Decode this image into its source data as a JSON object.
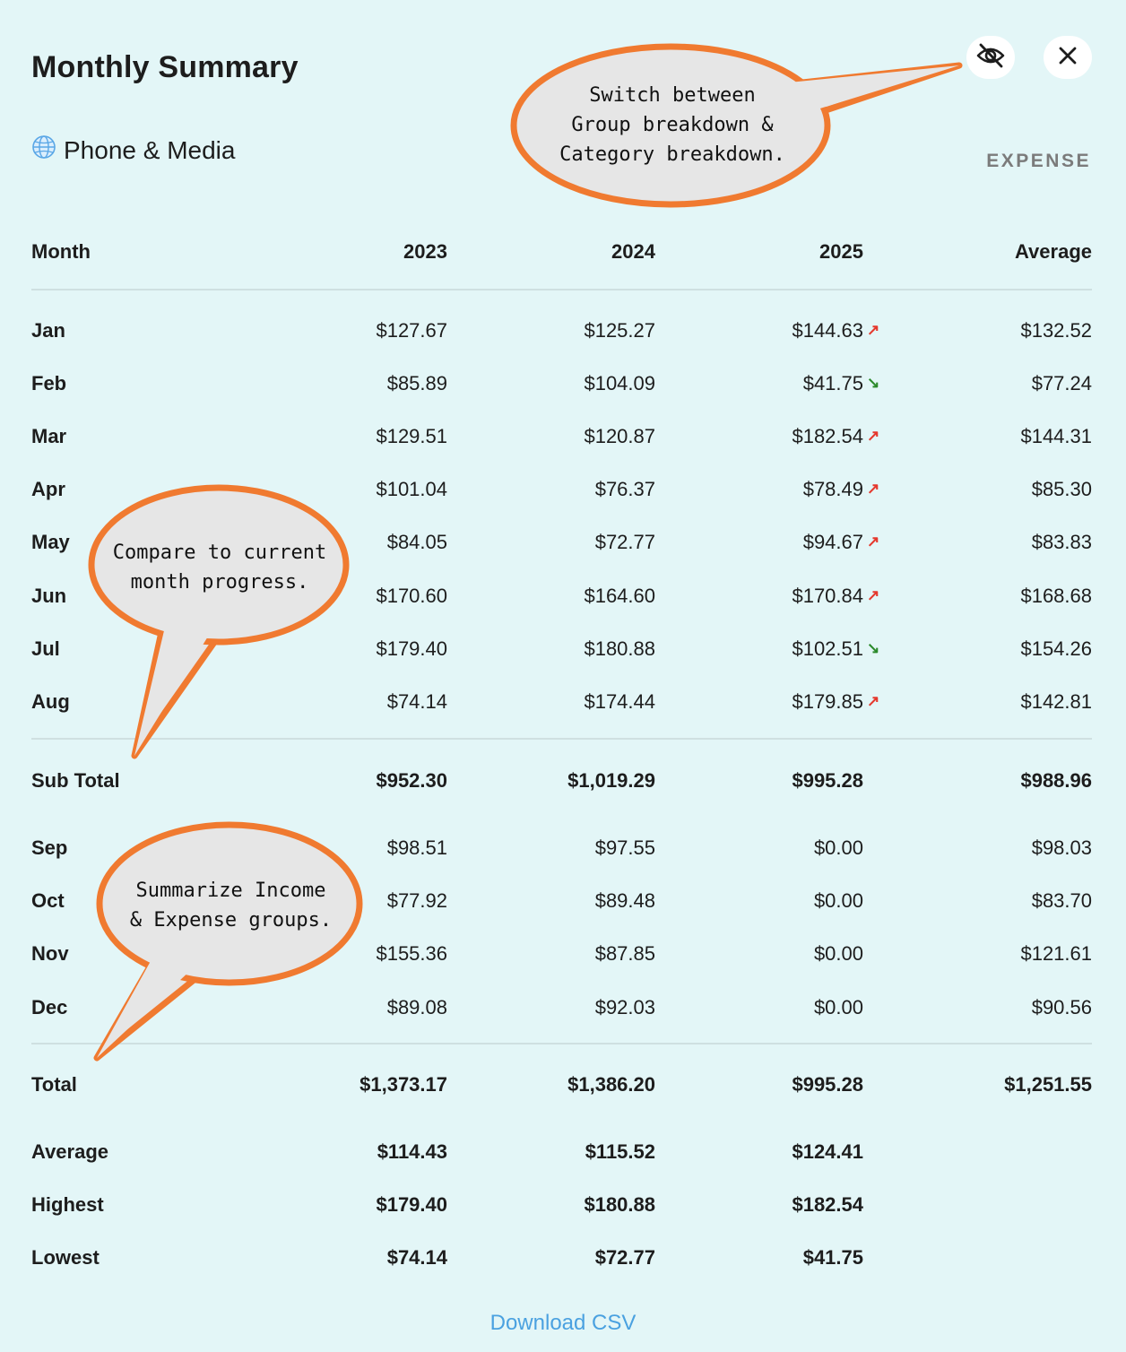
{
  "header": {
    "title": "Monthly Summary",
    "category": "Phone & Media",
    "category_icon": "globe-icon",
    "type_label": "EXPENSE",
    "toggle_icon": "eye-off-icon",
    "close_icon": "close-icon"
  },
  "table": {
    "columns": [
      "Month",
      "2023",
      "2024",
      "2025",
      "Average"
    ],
    "months_first": [
      {
        "month": "Jan",
        "y2023": "$127.67",
        "y2024": "$125.27",
        "y2025": "$144.63",
        "trend": "up",
        "avg": "$132.52"
      },
      {
        "month": "Feb",
        "y2023": "$85.89",
        "y2024": "$104.09",
        "y2025": "$41.75",
        "trend": "down",
        "avg": "$77.24"
      },
      {
        "month": "Mar",
        "y2023": "$129.51",
        "y2024": "$120.87",
        "y2025": "$182.54",
        "trend": "up",
        "avg": "$144.31"
      },
      {
        "month": "Apr",
        "y2023": "$101.04",
        "y2024": "$76.37",
        "y2025": "$78.49",
        "trend": "up",
        "avg": "$85.30"
      },
      {
        "month": "May",
        "y2023": "$84.05",
        "y2024": "$72.77",
        "y2025": "$94.67",
        "trend": "up",
        "avg": "$83.83"
      },
      {
        "month": "Jun",
        "y2023": "$170.60",
        "y2024": "$164.60",
        "y2025": "$170.84",
        "trend": "up",
        "avg": "$168.68"
      },
      {
        "month": "Jul",
        "y2023": "$179.40",
        "y2024": "$180.88",
        "y2025": "$102.51",
        "trend": "down",
        "avg": "$154.26"
      },
      {
        "month": "Aug",
        "y2023": "$74.14",
        "y2024": "$174.44",
        "y2025": "$179.85",
        "trend": "up",
        "avg": "$142.81"
      }
    ],
    "subtotal": {
      "label": "Sub Total",
      "y2023": "$952.30",
      "y2024": "$1,019.29",
      "y2025": "$995.28",
      "avg": "$988.96"
    },
    "months_rest": [
      {
        "month": "Sep",
        "y2023": "$98.51",
        "y2024": "$97.55",
        "y2025": "$0.00",
        "avg": "$98.03"
      },
      {
        "month": "Oct",
        "y2023": "$77.92",
        "y2024": "$89.48",
        "y2025": "$0.00",
        "avg": "$83.70"
      },
      {
        "month": "Nov",
        "y2023": "$155.36",
        "y2024": "$87.85",
        "y2025": "$0.00",
        "avg": "$121.61"
      },
      {
        "month": "Dec",
        "y2023": "$89.08",
        "y2024": "$92.03",
        "y2025": "$0.00",
        "avg": "$90.56"
      }
    ],
    "stats": [
      {
        "label": "Total",
        "y2023": "$1,373.17",
        "y2024": "$1,386.20",
        "y2025": "$995.28",
        "avg": "$1,251.55"
      },
      {
        "label": "Average",
        "y2023": "$114.43",
        "y2024": "$115.52",
        "y2025": "$124.41",
        "avg": ""
      },
      {
        "label": "Highest",
        "y2023": "$179.40",
        "y2024": "$180.88",
        "y2025": "$182.54",
        "avg": ""
      },
      {
        "label": "Lowest",
        "y2023": "$74.14",
        "y2024": "$72.77",
        "y2025": "$41.75",
        "avg": ""
      }
    ]
  },
  "trend_colors": {
    "up": "#e5382d",
    "down": "#2b8a2b"
  },
  "footer": {
    "download_label": "Download CSV"
  },
  "callouts": {
    "toggle": [
      "Switch between",
      "Group breakdown &",
      "Category breakdown."
    ],
    "compare": [
      "Compare to current",
      "month progress."
    ],
    "summarize": [
      "Summarize Income",
      "& Expense groups."
    ],
    "color_border": "#f07a30",
    "color_fill": "#e6e6e6"
  }
}
